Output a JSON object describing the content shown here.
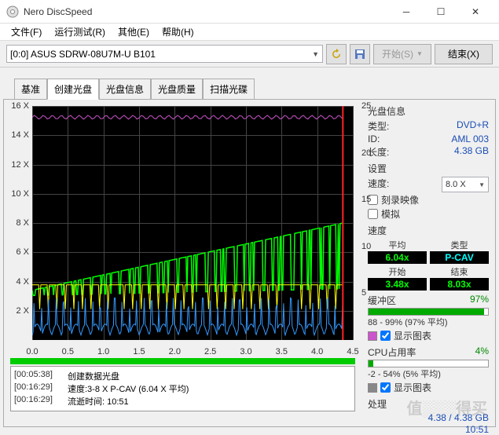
{
  "window": {
    "title": "Nero DiscSpeed"
  },
  "menu": {
    "file": "文件(F)",
    "run": "运行测试(R)",
    "other": "其他(E)",
    "help": "帮助(H)"
  },
  "toolbar": {
    "drive": "[0:0]   ASUS SDRW-08U7M-U B101",
    "start": "开始(S)",
    "end": "结束(X)"
  },
  "tabs": {
    "basic": "基准",
    "create": "创建光盘",
    "info": "光盘信息",
    "quality": "光盘质量",
    "scan": "扫描光碟"
  },
  "status": {
    "lines": [
      {
        "time": "[00:05:38]",
        "text": "创建数据光盘"
      },
      {
        "time": "[00:16:29]",
        "text": "速度:3-8 X P-CAV (6.04 X 平均)"
      },
      {
        "time": "[00:16:29]",
        "text": "流逝时间:         10:51"
      }
    ]
  },
  "panel": {
    "discinfo": {
      "title": "光盘信息",
      "type_l": "类型:",
      "type_v": "DVD+R",
      "id_l": "ID:",
      "id_v": "AML 003",
      "len_l": "长度:",
      "len_v": "4.38 GB"
    },
    "settings": {
      "title": "设置",
      "speed_l": "速度:",
      "speed_v": "8.0 X",
      "burn": "刻录映像",
      "sim": "模拟"
    },
    "speed": {
      "title": "速度",
      "avg_l": "平均",
      "avg_v": "6.04x",
      "type_l": "类型",
      "type_v": "P-CAV",
      "start_l": "开始",
      "start_v": "3.48x",
      "end_l": "结束",
      "end_v": "8.03x"
    },
    "buffer": {
      "title": "缓冲区",
      "pct": "97%",
      "range": "88 - 99% (97% 平均)",
      "show": "显示图表",
      "color": "#00aa00"
    },
    "cpu": {
      "title": "CPU占用率",
      "pct": "4%",
      "range": "-2 - 54% (5% 平均)",
      "show": "显示图表",
      "color": "#888888"
    },
    "proc": {
      "title": "处理",
      "gb": "4.38 / 4.38 GB",
      "time": "10:51"
    }
  },
  "chart_data": {
    "type": "line",
    "xlabel": "",
    "ylabel": "",
    "x_ticks": [
      "0.0",
      "0.5",
      "1.0",
      "1.5",
      "2.0",
      "2.5",
      "3.0",
      "3.5",
      "4.0",
      "4.5"
    ],
    "y_ticks_left": [
      "2 X",
      "4 X",
      "6 X",
      "8 X",
      "10 X",
      "12 X",
      "14 X",
      "16 X"
    ],
    "y_ticks_right": [
      "5",
      "10",
      "15",
      "20",
      "25"
    ],
    "xlim": [
      0.0,
      4.5
    ],
    "ylim_left": [
      0,
      16
    ],
    "ylim_right": [
      0,
      25
    ],
    "marker_x": 4.36,
    "series": [
      {
        "name": "write-speed",
        "axis": "left",
        "color": "#00ff00",
        "x": [
          0.0,
          0.5,
          1.0,
          1.5,
          2.0,
          2.5,
          3.0,
          3.5,
          4.0,
          4.36
        ],
        "y": [
          3.4,
          4.1,
          4.7,
          5.3,
          5.9,
          6.5,
          7.0,
          7.5,
          8.0,
          8.0
        ],
        "note": "frequent downward spikes to ~3x along the whole span"
      },
      {
        "name": "buffer-level",
        "axis": "right",
        "color": "#ffff00",
        "x": [
          0.0,
          4.36
        ],
        "y": [
          5.9,
          5.9
        ],
        "note": "flat near y≈5.9 with many brief dips to ~3.3"
      },
      {
        "name": "rpm",
        "axis": "right",
        "color": "#cc55cc",
        "x": [
          0.0,
          4.36
        ],
        "y": [
          23.8,
          23.8
        ],
        "note": "flat near top"
      },
      {
        "name": "cpu",
        "axis": "right",
        "color": "#3399ff",
        "x": [
          0.0,
          0.5,
          1.0,
          1.5,
          2.0,
          2.5,
          3.0,
          3.5,
          4.0,
          4.36
        ],
        "y": [
          0.5,
          0.7,
          1.2,
          0.6,
          1.8,
          2.2,
          0.9,
          2.1,
          1.0,
          3.0
        ],
        "note": "noisy low trace with spikes up to ~4"
      }
    ]
  }
}
